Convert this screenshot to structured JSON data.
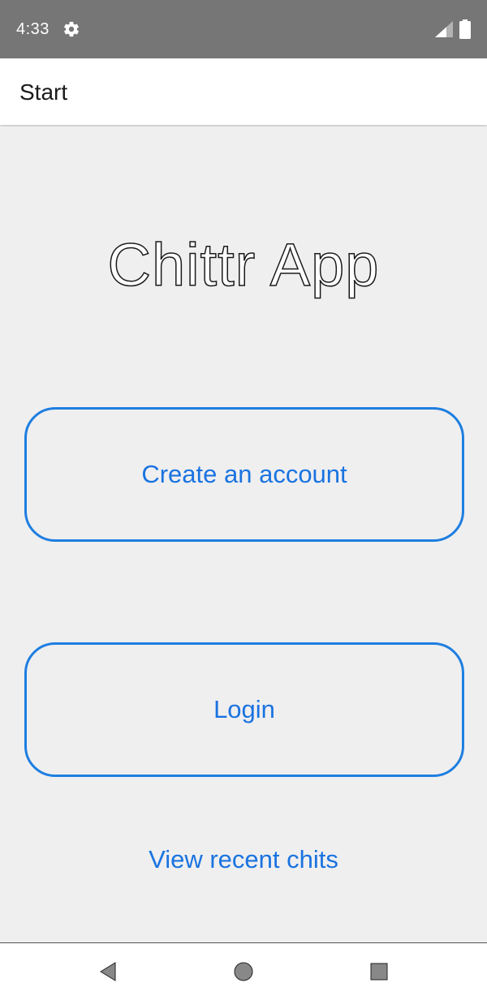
{
  "status_bar": {
    "time": "4:33",
    "icons": [
      "gear-icon",
      "signal-icon",
      "battery-icon"
    ]
  },
  "header": {
    "title": "Start"
  },
  "main": {
    "app_title": "Chittr App",
    "create_account_label": "Create an account",
    "login_label": "Login",
    "view_recent_label": "View recent chits"
  },
  "nav_bar": {
    "icons": [
      "back-icon",
      "home-icon",
      "recents-icon"
    ]
  },
  "colors": {
    "accent": "#1a73e0",
    "background": "#efeff0",
    "status_bar": "#767676"
  }
}
